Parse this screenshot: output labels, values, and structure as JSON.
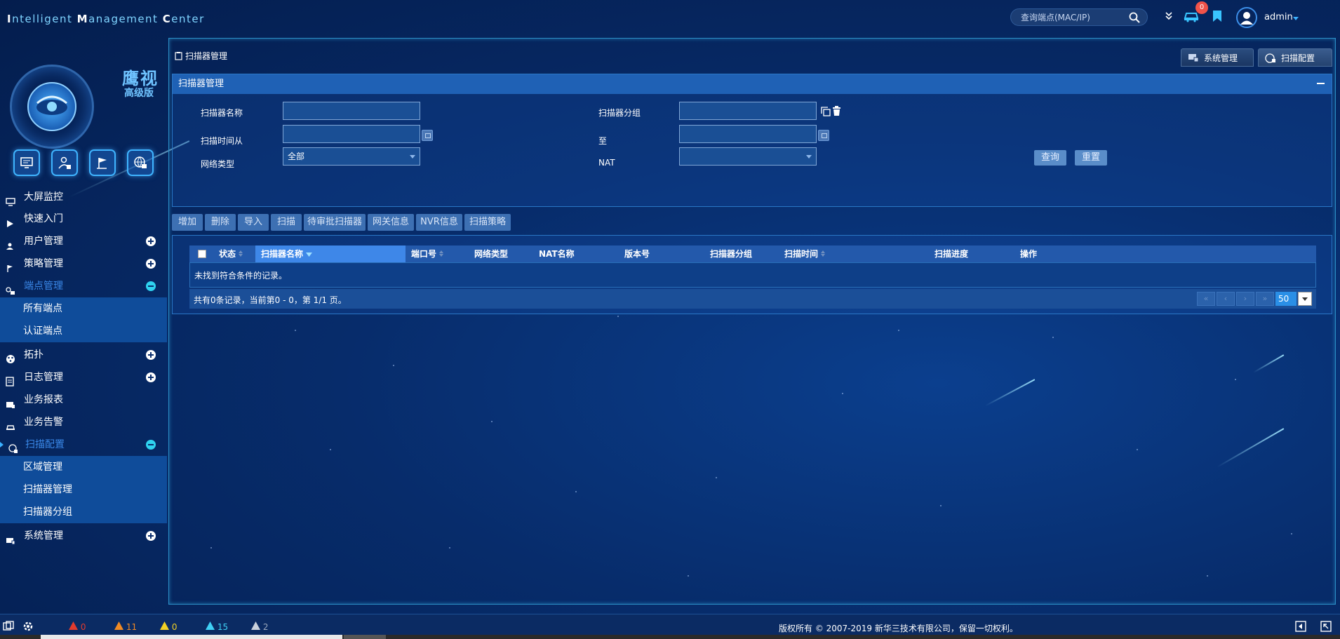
{
  "app": {
    "brand_parts": [
      {
        "cap": "I",
        "rest": "ntelligent "
      },
      {
        "cap": "M",
        "rest": "anagement "
      },
      {
        "cap": "C",
        "rest": "enter"
      }
    ]
  },
  "topbar": {
    "search_placeholder": "查询端点(MAC/IP)",
    "alarm_count": "0",
    "username": "admin"
  },
  "logo": {
    "title": "鹰视",
    "subtitle": "高级版"
  },
  "sidebar": {
    "menu": [
      {
        "label": "大屏监控"
      },
      {
        "label": "快速入门"
      },
      {
        "label": "用户管理"
      },
      {
        "label": "策略管理"
      },
      {
        "label": "端点管理"
      },
      {
        "label": "所有端点"
      },
      {
        "label": "认证端点"
      },
      {
        "label": "拓扑"
      },
      {
        "label": "日志管理"
      },
      {
        "label": "业务报表"
      },
      {
        "label": "业务告警"
      },
      {
        "label": "扫描配置"
      },
      {
        "label": "区域管理"
      },
      {
        "label": "扫描器管理"
      },
      {
        "label": "扫描器分组"
      },
      {
        "label": "系统管理"
      }
    ]
  },
  "main": {
    "breadcrumb": "扫描器管理",
    "tabs": [
      "系统管理",
      "扫描配置"
    ],
    "panel_title": "扫描器管理",
    "form": {
      "scanner_name_label": "扫描器名称",
      "scanner_group_label": "扫描器分组",
      "scan_time_from_label": "扫描时间从",
      "scan_time_to_label": "至",
      "network_type_label": "网络类型",
      "network_type_value": "全部",
      "nat_label": "NAT",
      "nat_value": "",
      "query_button": "查询",
      "reset_button": "重置"
    },
    "toolbar": [
      "增加",
      "删除",
      "导入",
      "扫描",
      "待审批扫描器",
      "网关信息",
      "NVR信息",
      "扫描策略"
    ],
    "table": {
      "columns": [
        "状态",
        "扫描器名称",
        "端口号",
        "网络类型",
        "NAT名称",
        "版本号",
        "扫描器分组",
        "扫描时间",
        "扫描进度",
        "操作"
      ],
      "empty_message": "未找到符合条件的记录。",
      "pager_text": "共有0条记录，当前第0 - 0，第 1/1 页。",
      "page_size": "50"
    }
  },
  "footer": {
    "alarms": [
      {
        "count": "0",
        "color": "#e23b2e"
      },
      {
        "count": "11",
        "color": "#f08a24"
      },
      {
        "count": "0",
        "color": "#f2d024"
      },
      {
        "count": "15",
        "color": "#3fd0f5"
      },
      {
        "count": "2",
        "color": "#9aa8bd"
      }
    ],
    "copyright": "版权所有 © 2007-2019 新华三技术有限公司，保留一切权利。"
  }
}
